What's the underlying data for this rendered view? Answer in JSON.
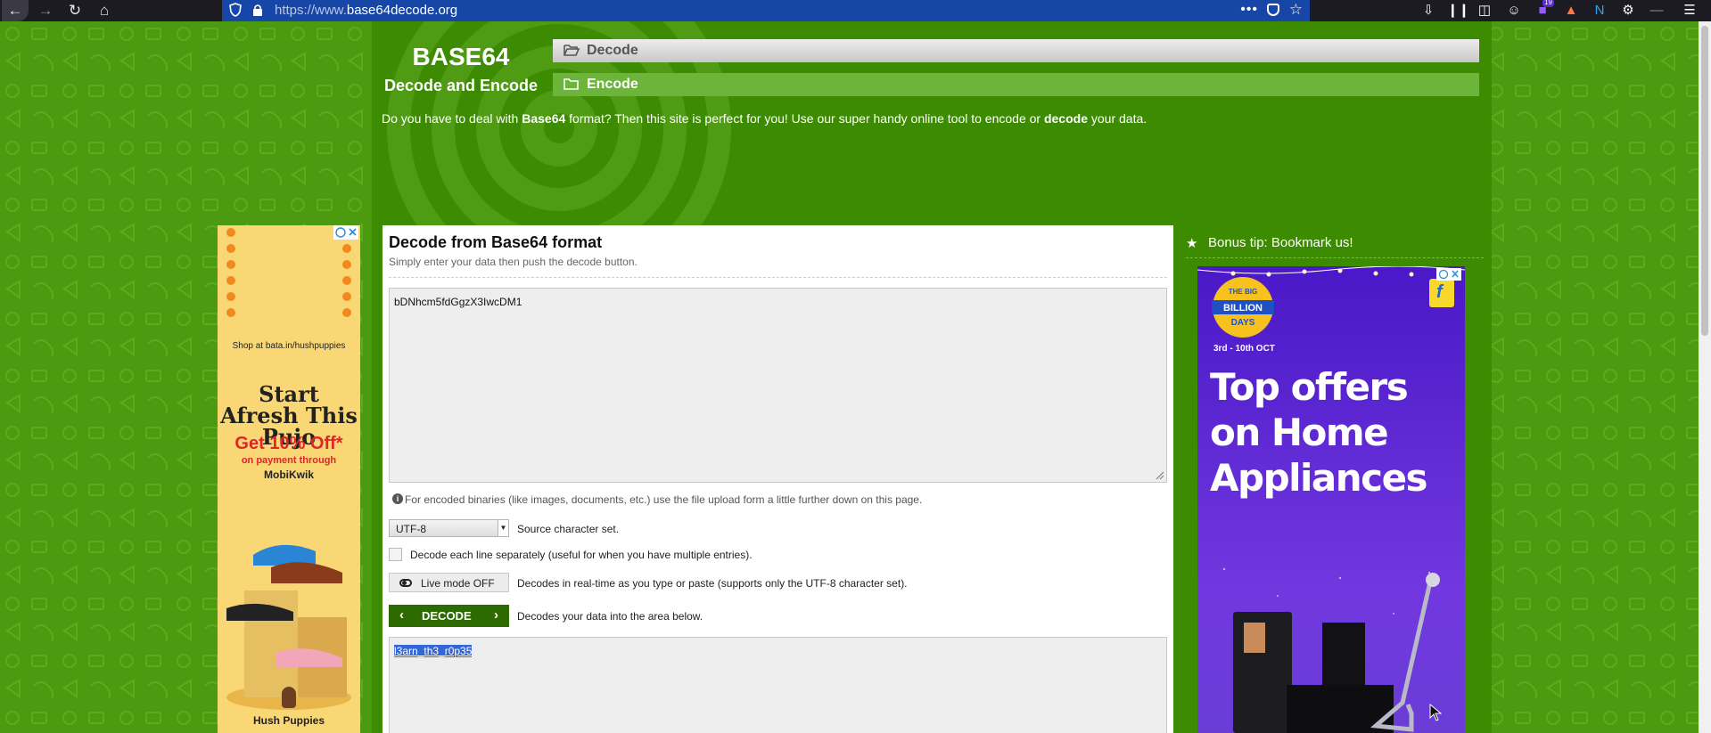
{
  "browser": {
    "url_proto": "https://www.",
    "url_domain": "base64decode.org",
    "notification_count": "19"
  },
  "header": {
    "logo_title": "BASE64",
    "logo_subtitle": "Decode and Encode",
    "menu": [
      {
        "label": "Decode",
        "icon": "folder-open-icon"
      },
      {
        "label": "Encode",
        "icon": "folder-icon"
      }
    ],
    "intro_prefix": "Do you have to deal with ",
    "intro_bold1": "Base64",
    "intro_middle": " format? Then this site is perfect for you! Use our super handy online tool to encode or ",
    "intro_bold2": "decode",
    "intro_suffix": " your data."
  },
  "main": {
    "title": "Decode from Base64 format",
    "subtitle": "Simply enter your data then push the decode button.",
    "input_value": "bDNhcm5fdGgzX3IwcDM1",
    "binary_hint": "For encoded binaries (like images, documents, etc.) use the file upload form a little further down on this page.",
    "charset_selected": "UTF-8",
    "charset_label": "Source character set.",
    "each_line_label": "Decode each line separately (useful for when you have multiple entries).",
    "live_mode_label": "Live mode OFF",
    "live_mode_desc": "Decodes in real-time as you type or paste (supports only the UTF-8 character set).",
    "decode_button": "DECODE",
    "decode_desc": "Decodes your data into the area below.",
    "output_value": "l3arn_th3_r0p35"
  },
  "sidebar": {
    "bonus_tip": "Bonus tip: Bookmark us!"
  },
  "ads": {
    "left": {
      "shop_text": "Shop at bata.in/hushpuppies",
      "headline": "Start Afresh This Pujo",
      "offer": "Get 10% Off*",
      "payment": "on payment through",
      "wallet": "MobiKwik",
      "brand": "Hush Puppies"
    },
    "right": {
      "badge_top": "THE BIG",
      "badge_main": "BILLION",
      "badge_bottom": "DAYS",
      "dates": "3rd - 10th OCT",
      "headline": "Top offers on Home Appliances"
    }
  }
}
